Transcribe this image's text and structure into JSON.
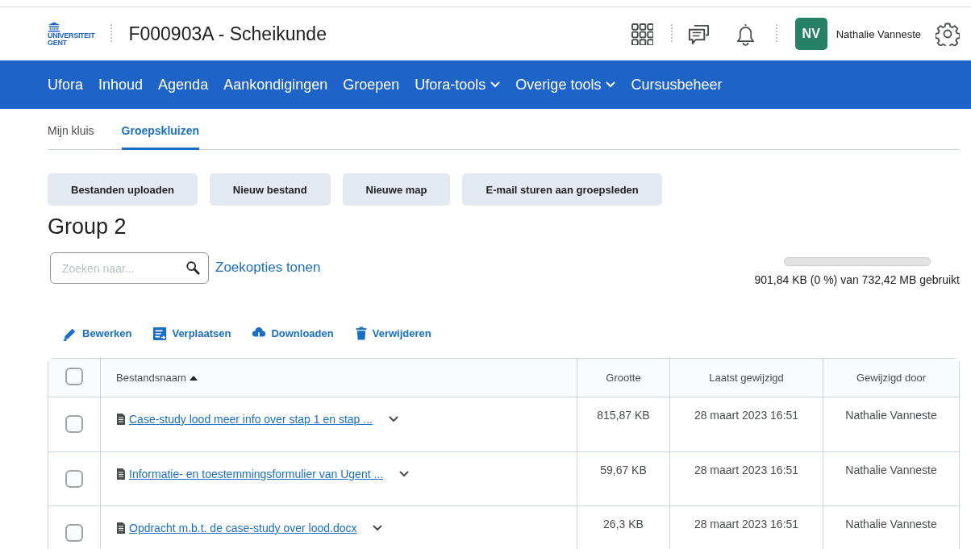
{
  "header": {
    "logo_lines": [
      "UNIVERSITEIT",
      "GENT"
    ],
    "course_title": "F000903A - Scheikunde",
    "avatar_initials": "NV",
    "user_name": "Nathalie Vanneste"
  },
  "nav": [
    {
      "label": "Ufora",
      "dropdown": false
    },
    {
      "label": "Inhoud",
      "dropdown": false
    },
    {
      "label": "Agenda",
      "dropdown": false
    },
    {
      "label": "Aankondigingen",
      "dropdown": false
    },
    {
      "label": "Groepen",
      "dropdown": false
    },
    {
      "label": "Ufora-tools",
      "dropdown": true
    },
    {
      "label": "Overige tools",
      "dropdown": true
    },
    {
      "label": "Cursusbeheer",
      "dropdown": false
    }
  ],
  "tabs": [
    {
      "label": "Mijn kluis",
      "selected": false
    },
    {
      "label": "Groepskluizen",
      "selected": true
    }
  ],
  "actions": [
    "Bestanden uploaden",
    "Nieuw bestand",
    "Nieuwe map",
    "E-mail sturen aan groepsleden"
  ],
  "group_title": "Group 2",
  "search": {
    "placeholder": "Zoeken naar...",
    "options_link": "Zoekopties tonen"
  },
  "storage": {
    "level": 0,
    "reading": "901,84 KB (0 %) van 732,42 MB gebruikt"
  },
  "toolbar": [
    {
      "kind": "edit",
      "label": "Bewerken"
    },
    {
      "kind": "move",
      "label": "Verplaatsen"
    },
    {
      "kind": "download",
      "label": "Downloaden"
    },
    {
      "kind": "delete",
      "label": "Verwijderen"
    }
  ],
  "table": {
    "select_all_checked": false,
    "columns": [
      "Bestandsnaam",
      "Grootte",
      "Laatst gewijzigd",
      "Gewijzigd door"
    ],
    "rows": [
      {
        "checked": false,
        "name": "Case-study lood meer info over stap 1 en stap ...",
        "size": "815,87 KB",
        "modified": "28 maart 2023 16:51",
        "modified_by": "Nathalie Vanneste"
      },
      {
        "checked": false,
        "name": "Informatie- en toestemmingsformulier van Ugent ...",
        "size": "59,67 KB",
        "modified": "28 maart 2023 16:51",
        "modified_by": "Nathalie Vanneste"
      },
      {
        "checked": false,
        "name": "Opdracht m.b.t. de case-study over lood.docx",
        "size": "26,3 KB",
        "modified": "28 maart 2023 16:51",
        "modified_by": "Nathalie Vanneste"
      }
    ]
  }
}
